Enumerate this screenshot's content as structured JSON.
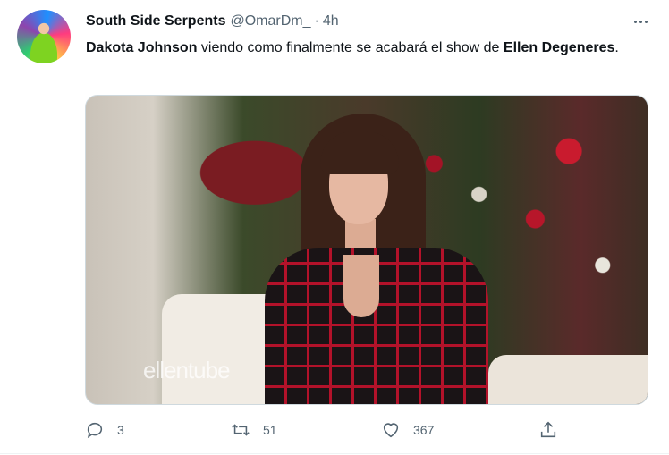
{
  "tweet": {
    "display_name": "South Side Serpents",
    "handle": "@OmarDm_",
    "separator": "·",
    "time": "4h",
    "text": {
      "part1": "Dakota Johnson",
      "part2": " viendo como finalmente se acabará el show de ",
      "part3": "Ellen Degeneres",
      "part4": "."
    },
    "media": {
      "watermark": "ellentube"
    },
    "actions": {
      "reply_count": "3",
      "retweet_count": "51",
      "like_count": "367"
    },
    "icons": [
      "more-icon",
      "reply-icon",
      "retweet-icon",
      "like-icon",
      "share-icon"
    ]
  }
}
